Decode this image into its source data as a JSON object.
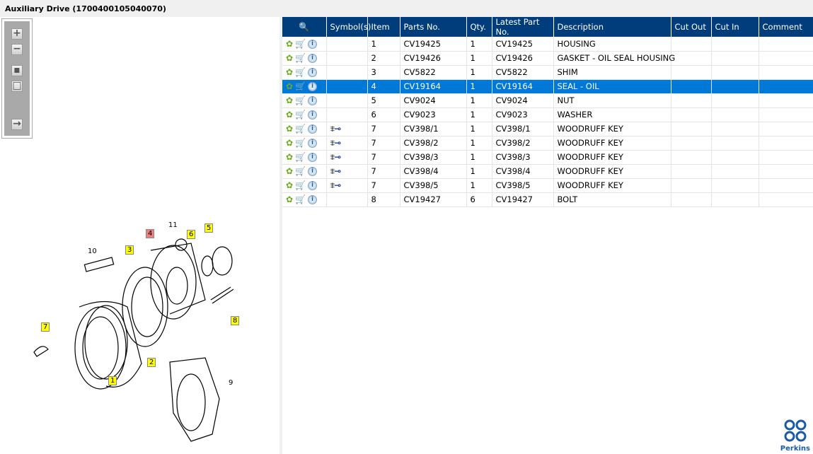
{
  "title": "Auxiliary Drive (1700400105040070)",
  "toolbar": [
    {
      "name": "zoom-in",
      "glyph": "+"
    },
    {
      "name": "zoom-out",
      "glyph": "−"
    },
    {
      "name": "fit-all",
      "glyph": "▪"
    },
    {
      "name": "reset-view",
      "glyph": "□"
    },
    {
      "name": "export",
      "glyph": "→"
    }
  ],
  "diagram": {
    "callouts": [
      {
        "n": "1",
        "style": "yellow"
      },
      {
        "n": "2",
        "style": "yellow"
      },
      {
        "n": "3",
        "style": "yellow"
      },
      {
        "n": "4",
        "style": "red"
      },
      {
        "n": "5",
        "style": "yellow"
      },
      {
        "n": "6",
        "style": "yellow"
      },
      {
        "n": "7",
        "style": "yellow"
      },
      {
        "n": "8",
        "style": "yellow"
      },
      {
        "n": "9",
        "style": "plain"
      },
      {
        "n": "10",
        "style": "plain"
      },
      {
        "n": "11",
        "style": "plain"
      }
    ]
  },
  "table": {
    "headers": [
      "",
      "Symbol(s)",
      "Item",
      "Parts No.",
      "Qty.",
      "Latest Part No.",
      "Description",
      "Cut Out",
      "Cut In",
      "Comment"
    ],
    "selected_index": 3,
    "rows": [
      {
        "item": "1",
        "part": "CV19425",
        "qty": "1",
        "latest": "CV19425",
        "desc": "HOUSING",
        "sym": false
      },
      {
        "item": "2",
        "part": "CV19426",
        "qty": "1",
        "latest": "CV19426",
        "desc": "GASKET - OIL SEAL HOUSING",
        "sym": false
      },
      {
        "item": "3",
        "part": "CV5822",
        "qty": "1",
        "latest": "CV5822",
        "desc": "SHIM",
        "sym": false
      },
      {
        "item": "4",
        "part": "CV19164",
        "qty": "1",
        "latest": "CV19164",
        "desc": "SEAL - OIL",
        "sym": false
      },
      {
        "item": "5",
        "part": "CV9024",
        "qty": "1",
        "latest": "CV9024",
        "desc": "NUT",
        "sym": false
      },
      {
        "item": "6",
        "part": "CV9023",
        "qty": "1",
        "latest": "CV9023",
        "desc": "WASHER",
        "sym": false
      },
      {
        "item": "7",
        "part": "CV398/1",
        "qty": "1",
        "latest": "CV398/1",
        "desc": "WOODRUFF KEY",
        "sym": true
      },
      {
        "item": "7",
        "part": "CV398/2",
        "qty": "1",
        "latest": "CV398/2",
        "desc": "WOODRUFF KEY",
        "sym": true
      },
      {
        "item": "7",
        "part": "CV398/3",
        "qty": "1",
        "latest": "CV398/3",
        "desc": "WOODRUFF KEY",
        "sym": true
      },
      {
        "item": "7",
        "part": "CV398/4",
        "qty": "1",
        "latest": "CV398/4",
        "desc": "WOODRUFF KEY",
        "sym": true
      },
      {
        "item": "7",
        "part": "CV398/5",
        "qty": "1",
        "latest": "CV398/5",
        "desc": "WOODRUFF KEY",
        "sym": true
      },
      {
        "item": "8",
        "part": "CV19427",
        "qty": "6",
        "latest": "CV19427",
        "desc": "BOLT",
        "sym": false
      }
    ]
  },
  "logo": "Perkins",
  "colors": {
    "header": "#003d7a",
    "selected": "#0078d7",
    "callout_yellow": "#ffff00",
    "callout_red": "#f08080"
  }
}
